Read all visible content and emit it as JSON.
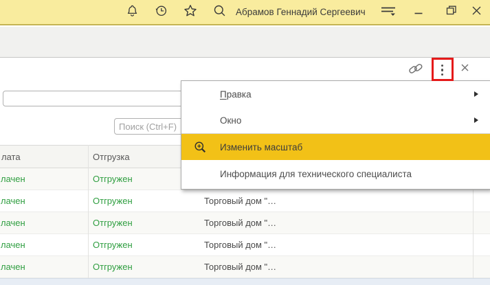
{
  "topbar": {
    "user_name": "Абрамов Геннадий Сергеевич",
    "icons": [
      "bell-icon",
      "history-icon",
      "star-icon",
      "search-icon",
      "service-menu-icon",
      "minimize-icon",
      "restore-icon",
      "close-icon"
    ]
  },
  "form_toolbar": {
    "icons": [
      "link-icon",
      "kebab-menu-icon",
      "close-icon"
    ]
  },
  "search": {
    "placeholder": "Поиск (Ctrl+F)"
  },
  "context_menu": {
    "items": [
      {
        "label": "Правка",
        "label_hotkey": "П",
        "label_rest": "равка",
        "has_submenu": true
      },
      {
        "label": "Окно",
        "has_submenu": true
      },
      {
        "label": "Изменить масштаб",
        "icon": "zoom-in-icon",
        "highlighted": true
      },
      {
        "label": "Информация для технического специалиста"
      }
    ]
  },
  "table": {
    "headers": [
      "лата",
      "Отгрузка"
    ],
    "rows": [
      {
        "payment": "лачен",
        "shipment": "Отгружен",
        "customer": ""
      },
      {
        "payment": "лачен",
        "shipment": "Отгружен",
        "customer": "Торговый дом \"…"
      },
      {
        "payment": "лачен",
        "shipment": "Отгружен",
        "customer": "Торговый дом \"…"
      },
      {
        "payment": "лачен",
        "shipment": "Отгружен",
        "customer": "Торговый дом \"…"
      },
      {
        "payment": "лачен",
        "shipment": "Отгружен",
        "customer": "Торговый дом \"…"
      }
    ]
  },
  "annotation": {
    "target": "kebab-menu-button",
    "color": "#e51a1a"
  },
  "colors": {
    "topbar_bg": "#f9ec9e",
    "topbar_border": "#c4b454",
    "menu_highlight": "#f2c117",
    "status_green": "#2f9e40",
    "annotation_red": "#e51a1a",
    "selected_row_bg": "#e7edf5"
  }
}
